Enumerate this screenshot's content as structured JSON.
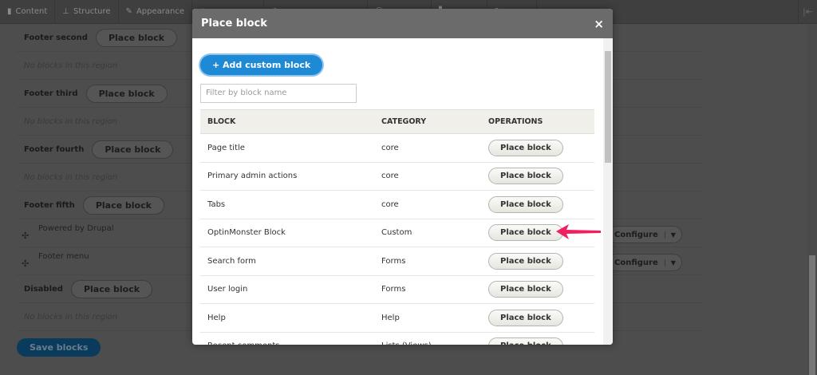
{
  "toolbar": {
    "items": [
      {
        "label": "Content",
        "icon": "file-icon"
      },
      {
        "label": "Structure",
        "icon": "sitemap-icon"
      },
      {
        "label": "Appearance",
        "icon": "brush-icon"
      },
      {
        "label": "",
        "icon": "extend-icon"
      },
      {
        "label": "",
        "icon": "config-icon"
      },
      {
        "label": "",
        "icon": "people-icon"
      },
      {
        "label": "",
        "icon": "reports-icon"
      },
      {
        "label": "",
        "icon": "help-icon"
      }
    ]
  },
  "page": {
    "regions": [
      {
        "name": "Footer second",
        "button": "Place block",
        "empty": "No blocks in this region"
      },
      {
        "name": "Footer third",
        "button": "Place block",
        "empty": "No blocks in this region"
      },
      {
        "name": "Footer fourth",
        "button": "Place block",
        "empty": "No blocks in this region"
      },
      {
        "name": "Footer fifth",
        "button": "Place block",
        "blocks": [
          {
            "name": "Powered by Drupal",
            "op": "Configure"
          },
          {
            "name": "Footer menu",
            "op": "Configure"
          }
        ]
      },
      {
        "name": "Disabled",
        "button": "Place block",
        "empty": "No blocks in this region"
      }
    ],
    "save": "Save blocks"
  },
  "modal": {
    "title": "Place block",
    "close": "×",
    "add_button": "+ Add custom block",
    "filter_placeholder": "Filter by block name",
    "columns": [
      "BLOCK",
      "CATEGORY",
      "OPERATIONS"
    ],
    "rows": [
      {
        "block": "Page title",
        "category": "core",
        "op": "Place block"
      },
      {
        "block": "Primary admin actions",
        "category": "core",
        "op": "Place block"
      },
      {
        "block": "Tabs",
        "category": "core",
        "op": "Place block"
      },
      {
        "block": "OptinMonster Block",
        "category": "Custom",
        "op": "Place block"
      },
      {
        "block": "Search form",
        "category": "Forms",
        "op": "Place block"
      },
      {
        "block": "User login",
        "category": "Forms",
        "op": "Place block"
      },
      {
        "block": "Help",
        "category": "Help",
        "op": "Place block"
      },
      {
        "block": "Recent comments",
        "category": "Lists (Views)",
        "op": "Place block"
      }
    ]
  },
  "colors": {
    "arrow": "#f0205e",
    "accent": "#1e8ad6"
  }
}
